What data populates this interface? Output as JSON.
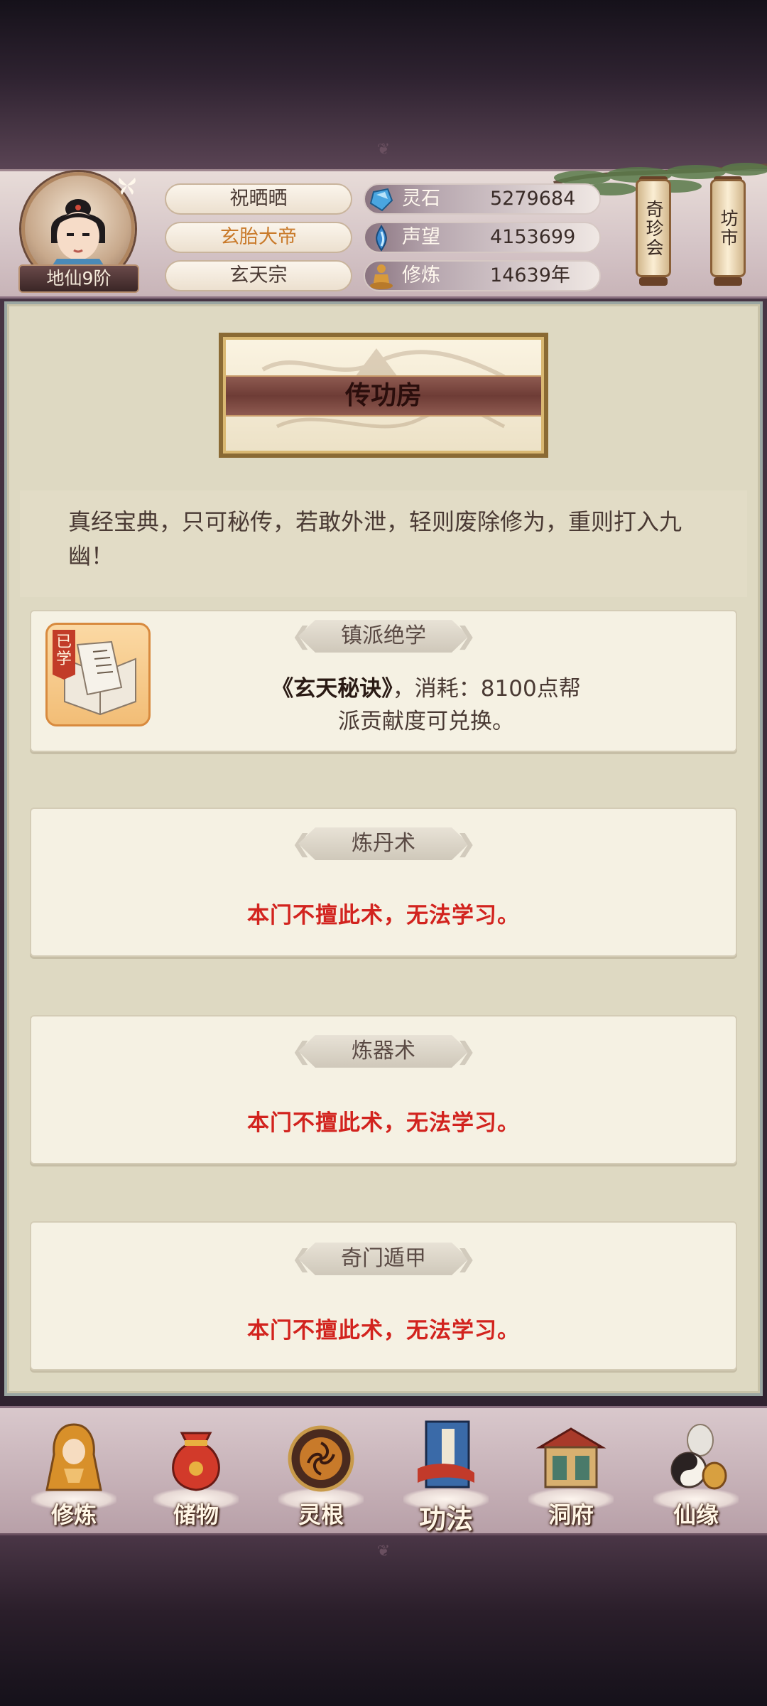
{
  "player": {
    "level": "地仙9阶",
    "name": "祝晒晒",
    "title": "玄胎大帝",
    "sect": "玄天宗"
  },
  "resources": [
    {
      "label": "灵石",
      "value": "5279684",
      "icon": "spirit-stone-icon"
    },
    {
      "label": "声望",
      "value": "4153699",
      "icon": "reputation-icon"
    },
    {
      "label": "修炼",
      "value": "14639年",
      "icon": "meditation-icon"
    }
  ],
  "shortcuts": {
    "treasure": "奇珍会",
    "market": "坊市"
  },
  "page": {
    "title": "传功房",
    "intro": "真经宝典，只可秘传，若敢外泄，轻则废除修为，重则打入九幽！"
  },
  "cards": [
    {
      "header": "镇派绝学",
      "learned_tag": "已学",
      "desc_book": "《玄天秘诀》",
      "desc_rest_1": "，消耗：8100点帮",
      "desc_rest_2": "派贡献度可兑换。"
    },
    {
      "header": "炼丹术",
      "message": "本门不擅此术，无法学习。"
    },
    {
      "header": "炼器术",
      "message": "本门不擅此术，无法学习。"
    },
    {
      "header": "奇门遁甲",
      "message": "本门不擅此术，无法学习。"
    }
  ],
  "nav": [
    {
      "label": "修炼",
      "icon": "cultivate-icon"
    },
    {
      "label": "储物",
      "icon": "storage-bag-icon"
    },
    {
      "label": "灵根",
      "icon": "spirit-root-icon"
    },
    {
      "label": "功法",
      "icon": "technique-book-icon",
      "active": true
    },
    {
      "label": "洞府",
      "icon": "cave-dwelling-icon"
    },
    {
      "label": "仙缘",
      "icon": "immortal-fate-icon"
    }
  ],
  "colors": {
    "accent_red": "#d2231e",
    "title_gold": "#c97a2a",
    "panel_bg": "#ded9c2"
  }
}
